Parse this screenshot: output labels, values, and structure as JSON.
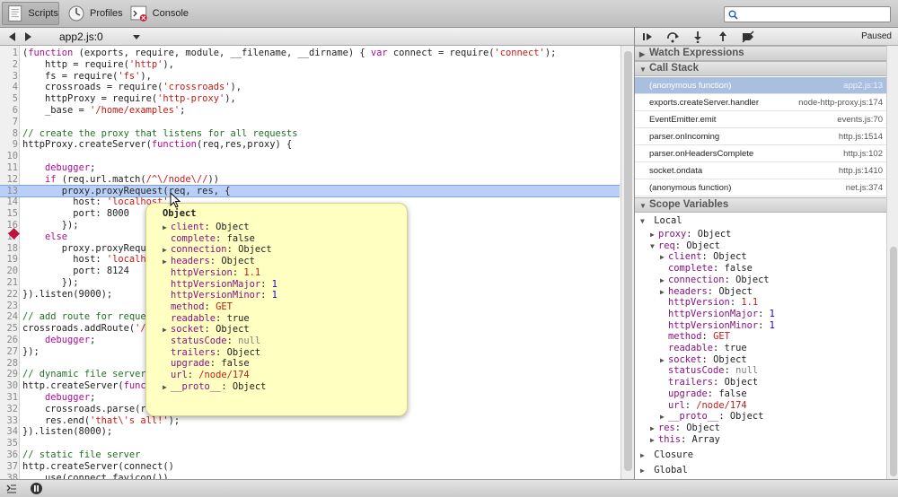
{
  "toolbar": {
    "tabs": [
      {
        "label": "Scripts",
        "icon": "scripts-icon",
        "active": true
      },
      {
        "label": "Profiles",
        "icon": "profiles-icon",
        "active": false
      },
      {
        "label": "Console",
        "icon": "console-icon",
        "active": false
      }
    ],
    "search": {
      "value": "",
      "placeholder": ""
    }
  },
  "source": {
    "file_name": "app2.js:0",
    "highlighted_line": 13,
    "breakpoint_line": 13,
    "lines": [
      {
        "n": "1",
        "text": "(function (exports, require, module, __filename, __dirname) { var connect = require('connect');"
      },
      {
        "n": "2",
        "text": "    http = require('http'),"
      },
      {
        "n": "3",
        "text": "    fs = require('fs'),"
      },
      {
        "n": "4",
        "text": "    crossroads = require('crossroads'),"
      },
      {
        "n": "5",
        "text": "    httpProxy = require('http-proxy'),"
      },
      {
        "n": "6",
        "text": "    _base = '/home/examples';"
      },
      {
        "n": "7",
        "text": ""
      },
      {
        "n": "8",
        "text": "// create the proxy that listens for all requests"
      },
      {
        "n": "9",
        "text": "httpProxy.createServer(function(req,res,proxy) {"
      },
      {
        "n": "10",
        "text": ""
      },
      {
        "n": "11",
        "text": "    debugger;"
      },
      {
        "n": "12",
        "text": "    if (req.url.match(/^\\/node\\//))"
      },
      {
        "n": "13",
        "text": "       proxy.proxyRequest(req, res, {"
      },
      {
        "n": "14",
        "text": "         host: 'localhost',"
      },
      {
        "n": "15",
        "text": "         port: 8000"
      },
      {
        "n": "16",
        "text": "       });"
      },
      {
        "n": "17",
        "text": "    else"
      },
      {
        "n": "18",
        "text": "       proxy.proxyRequest(req, res, {"
      },
      {
        "n": "19",
        "text": "         host: 'localhost',"
      },
      {
        "n": "20",
        "text": "         port: 8124"
      },
      {
        "n": "21",
        "text": "       });"
      },
      {
        "n": "22",
        "text": "}).listen(9000);"
      },
      {
        "n": "23",
        "text": ""
      },
      {
        "n": "24",
        "text": "// add route for request for dynamic resource"
      },
      {
        "n": "25",
        "text": "crossroads.addRoute('/node/{id}/', function(id) {"
      },
      {
        "n": "26",
        "text": "    debugger;"
      },
      {
        "n": "27",
        "text": "});"
      },
      {
        "n": "28",
        "text": ""
      },
      {
        "n": "29",
        "text": "// dynamic file server"
      },
      {
        "n": "30",
        "text": "http.createServer(function(req,res) {"
      },
      {
        "n": "31",
        "text": "    debugger;"
      },
      {
        "n": "32",
        "text": "    crossroads.parse(req.url);"
      },
      {
        "n": "33",
        "text": "    res.end('that\\'s all!');"
      },
      {
        "n": "34",
        "text": "}).listen(8000);"
      },
      {
        "n": "35",
        "text": ""
      },
      {
        "n": "36",
        "text": "// static file server"
      },
      {
        "n": "37",
        "text": "http.createServer(connect()"
      },
      {
        "n": "38",
        "text": "   .use(connect.favicon())"
      }
    ]
  },
  "popover": {
    "title": "Object",
    "rows": [
      {
        "expandable": true,
        "key": "client",
        "value": "Object",
        "kind": "def"
      },
      {
        "expandable": false,
        "key": "complete",
        "value": "false",
        "kind": "def"
      },
      {
        "expandable": true,
        "key": "connection",
        "value": "Object",
        "kind": "def"
      },
      {
        "expandable": true,
        "key": "headers",
        "value": "Object",
        "kind": "def"
      },
      {
        "expandable": false,
        "key": "httpVersion",
        "value": "1.1",
        "kind": "str"
      },
      {
        "expandable": false,
        "key": "httpVersionMajor",
        "value": "1",
        "kind": "num"
      },
      {
        "expandable": false,
        "key": "httpVersionMinor",
        "value": "1",
        "kind": "num"
      },
      {
        "expandable": false,
        "key": "method",
        "value": "GET",
        "kind": "str"
      },
      {
        "expandable": false,
        "key": "readable",
        "value": "true",
        "kind": "def"
      },
      {
        "expandable": true,
        "key": "socket",
        "value": "Object",
        "kind": "def"
      },
      {
        "expandable": false,
        "key": "statusCode",
        "value": "null",
        "kind": "null"
      },
      {
        "expandable": false,
        "key": "trailers",
        "value": "Object",
        "kind": "def"
      },
      {
        "expandable": false,
        "key": "upgrade",
        "value": "false",
        "kind": "def"
      },
      {
        "expandable": false,
        "key": "url",
        "value": "/node/174",
        "kind": "str"
      },
      {
        "expandable": true,
        "key": "__proto__",
        "value": "Object",
        "kind": "def"
      }
    ]
  },
  "debugger": {
    "status": "Paused",
    "sections": {
      "watch": "Watch Expressions",
      "call_stack": "Call Stack",
      "scope": "Scope Variables"
    },
    "call_stack": [
      {
        "fn": "(anonymous function)",
        "loc": "app2.js:13",
        "selected": true
      },
      {
        "fn": "exports.createServer.handler",
        "loc": "node-http-proxy.js:174",
        "selected": false
      },
      {
        "fn": "EventEmitter.emit",
        "loc": "events.js:70",
        "selected": false
      },
      {
        "fn": "parser.onIncoming",
        "loc": "http.js:1514",
        "selected": false
      },
      {
        "fn": "parser.onHeadersComplete",
        "loc": "http.js:102",
        "selected": false
      },
      {
        "fn": "socket.ondata",
        "loc": "http.js:1410",
        "selected": false
      },
      {
        "fn": "(anonymous function)",
        "loc": "net.js:374",
        "selected": false
      }
    ],
    "scope": {
      "local_label": "Local",
      "closure_label": "Closure",
      "global_label": "Global",
      "rows": [
        {
          "indent": 1,
          "tri": "right",
          "key": "proxy",
          "value": "Object",
          "kind": "def"
        },
        {
          "indent": 1,
          "tri": "down",
          "key": "req",
          "value": "Object",
          "kind": "def"
        },
        {
          "indent": 2,
          "tri": "right",
          "key": "client",
          "value": "Object",
          "kind": "def"
        },
        {
          "indent": 2,
          "tri": "none",
          "key": "complete",
          "value": "false",
          "kind": "def"
        },
        {
          "indent": 2,
          "tri": "right",
          "key": "connection",
          "value": "Object",
          "kind": "def"
        },
        {
          "indent": 2,
          "tri": "right",
          "key": "headers",
          "value": "Object",
          "kind": "def"
        },
        {
          "indent": 2,
          "tri": "none",
          "key": "httpVersion",
          "value": "1.1",
          "kind": "str"
        },
        {
          "indent": 2,
          "tri": "none",
          "key": "httpVersionMajor",
          "value": "1",
          "kind": "num"
        },
        {
          "indent": 2,
          "tri": "none",
          "key": "httpVersionMinor",
          "value": "1",
          "kind": "num"
        },
        {
          "indent": 2,
          "tri": "none",
          "key": "method",
          "value": "GET",
          "kind": "str"
        },
        {
          "indent": 2,
          "tri": "none",
          "key": "readable",
          "value": "true",
          "kind": "def"
        },
        {
          "indent": 2,
          "tri": "right",
          "key": "socket",
          "value": "Object",
          "kind": "def"
        },
        {
          "indent": 2,
          "tri": "none",
          "key": "statusCode",
          "value": "null",
          "kind": "null"
        },
        {
          "indent": 2,
          "tri": "none",
          "key": "trailers",
          "value": "Object",
          "kind": "def"
        },
        {
          "indent": 2,
          "tri": "none",
          "key": "upgrade",
          "value": "false",
          "kind": "def"
        },
        {
          "indent": 2,
          "tri": "none",
          "key": "url",
          "value": "/node/174",
          "kind": "str"
        },
        {
          "indent": 2,
          "tri": "right",
          "key": "__proto__",
          "value": "Object",
          "kind": "def"
        },
        {
          "indent": 1,
          "tri": "right",
          "key": "res",
          "value": "Object",
          "kind": "def"
        },
        {
          "indent": 1,
          "tri": "right",
          "key": "this",
          "value": "Array",
          "kind": "def"
        }
      ]
    }
  },
  "colors": {
    "breakpoint": "#c4103a",
    "highlight": "#b8d0f5",
    "popover_bg": "#ffffc2",
    "selected_row": "#a9bfe0"
  }
}
